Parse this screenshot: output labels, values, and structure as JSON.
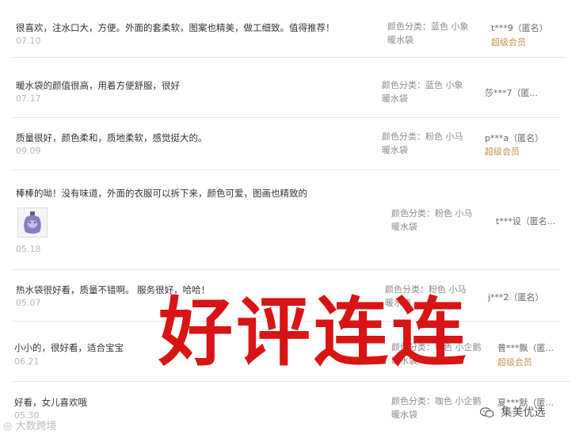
{
  "reviews": [
    {
      "text": "很喜欢，注水口大，方便。外面的套柔软，图案也精美，做工细致。值得推荐！",
      "date": "07.10",
      "sku": "颜色分类：蓝色 小象暖水袋",
      "user": "t***9（匿名）",
      "badge": "超级会员"
    },
    {
      "text": "暖水袋的颜值很高，用着方便舒服，很好",
      "date": "07.17",
      "sku": "颜色分类：蓝色 小象暖水袋",
      "user": "莎***7（匿...",
      "badge": ""
    },
    {
      "text": "质量很好，颜色柔和，质地柔软，感觉挺大的。",
      "date": "09.09",
      "sku": "颜色分类：粉色 小马暖水袋",
      "user": "p***a（匿名）",
      "badge": "超级会员"
    },
    {
      "text": "棒棒的呦！没有味道，外面的衣服可以拆下来，颜色可爱，图画也精致的",
      "date": "05.18",
      "sku": "颜色分类：粉色 小马暖水袋",
      "user": "t***设（匿名...",
      "badge": ""
    },
    {
      "text": "热水袋很好看，质量不错啊。 服务很好，哈哈！",
      "date": "05.07",
      "sku": "颜色分类：粉色 小马暖水袋",
      "user": "j***2（匿名）",
      "badge": ""
    },
    {
      "text": "小小的，很好看，适合宝宝",
      "date": "06.21",
      "sku": "颜色分类：咖色 小企鹅暖水袋",
      "user": "普***飘（匿...",
      "badge": "超级会员"
    },
    {
      "text": "好看，女儿喜欢哦",
      "date": "05.30",
      "sku": "颜色分类：咖色 小企鹅暖水袋",
      "user": "夏***默（匿...",
      "badge": ""
    }
  ],
  "overlay": {
    "stamp_text": "好评连连",
    "watermark_left": "大数跨境",
    "watermark_right": "集美优选"
  },
  "colors": {
    "stamp": "#d81414",
    "vip": "#c88f4a",
    "date": "#b8b8b8"
  }
}
